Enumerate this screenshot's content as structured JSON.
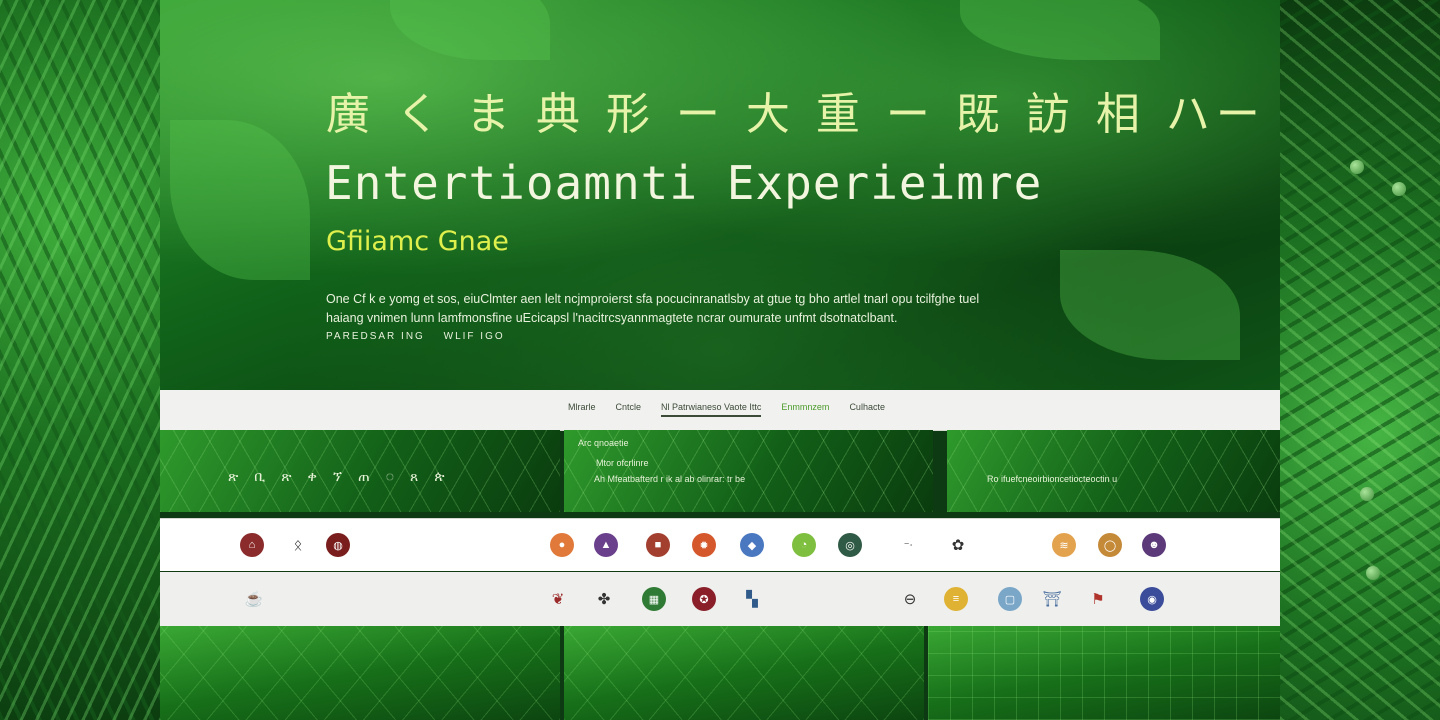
{
  "hero": {
    "cjk_heading": "廣 く ま 典  形 ー 大 重 ー 既  訪  相  ハー 塁",
    "title": "Entertioamnti Experieimre",
    "subtitle": "Gfiiamc Gnae",
    "description": "One Cf k e yomg et sos, eiuClmter aen lelt ncjmproierst sfa pocucinranatlsby at gtue tg bho artlel tnarl opu tcilfghe tuel haiang vnimen lunn lamfmonsfine uEcicapsl l'nacitrcsyannmagtete ncrar oumurate unfmt dsotnatclbant.",
    "cta": [
      "PAREDSAR ING",
      "WLIF IGO"
    ]
  },
  "nav": {
    "items": [
      {
        "label": "Mlrarle",
        "state": "normal"
      },
      {
        "label": "Cntcle",
        "state": "normal"
      },
      {
        "label": "Nl Patrwianeso Vaote Ittc",
        "state": "active"
      },
      {
        "label": "Enmmnzem",
        "state": "accent"
      },
      {
        "label": "Culhacte",
        "state": "normal"
      }
    ]
  },
  "cards": {
    "card1": {
      "icons": [
        "ጽ",
        "ቢ",
        "ጽ",
        "ቀ",
        "ኘ",
        "ጠ",
        "◌",
        "ጸ",
        "ጵ"
      ]
    },
    "card2": {
      "label": "Arc qnoaetie",
      "sub": "Mtor ofcrlinre",
      "line": "Ah Mfeatbafterd r ik   al ab olinrar: tr be"
    },
    "card3": {
      "line": "Ro ifuefcneoirbioncetiocteoctin u"
    }
  },
  "logos": {
    "row1": [
      "house-logo",
      "bird-logo",
      "tag-logo",
      "orange-logo",
      "crest-logo",
      "truck-logo",
      "gear-logo",
      "shield-logo",
      "swoosh-logo",
      "circle-logo",
      "dash-logo",
      "flower-logo",
      "road-logo",
      "ring-logo",
      "mask-logo"
    ],
    "row2": [
      "cup-logo",
      "leaf-logo",
      "paw-logo",
      "grid-logo",
      "badge-logo",
      "block-logo",
      "cross-logo",
      "burger-logo",
      "frame-logo",
      "bridge-logo",
      "flag-logo",
      "globe-logo"
    ]
  },
  "colors": {
    "accent_yellow": "#dff04c",
    "hero_text": "#f3f6de",
    "forest": "#11641a"
  }
}
